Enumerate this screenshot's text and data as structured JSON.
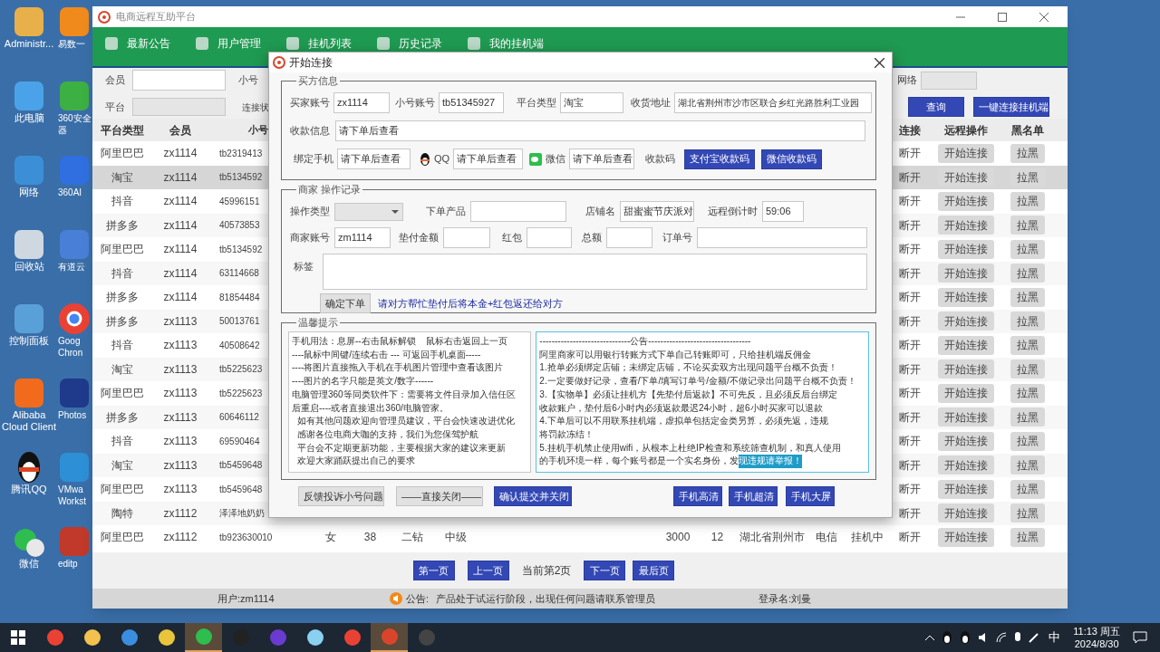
{
  "desktop": {
    "icons": [
      {
        "lines": [
          "Administr..."
        ]
      },
      {
        "lines": [
          "易数一"
        ]
      },
      {
        "lines": [
          "此电脑"
        ]
      },
      {
        "lines": [
          "360安全",
          "器"
        ]
      },
      {
        "lines": [
          "网络"
        ]
      },
      {
        "lines": [
          "360AI"
        ]
      },
      {
        "lines": [
          "回收站"
        ]
      },
      {
        "lines": [
          "有道云"
        ]
      },
      {
        "lines": [
          "控制面板"
        ]
      },
      {
        "lines": [
          "Goog",
          "Chron"
        ]
      },
      {
        "lines": [
          "Alibaba",
          "Cloud Client"
        ]
      },
      {
        "lines": [
          "Photos"
        ]
      },
      {
        "lines": [
          "腾讯QQ"
        ]
      },
      {
        "lines": [
          "VMwa",
          "Workst"
        ]
      },
      {
        "lines": [
          "微信"
        ]
      },
      {
        "lines": [
          "editp"
        ]
      }
    ]
  },
  "window": {
    "title": "电商远程互助平台",
    "nav": [
      "最新公告",
      "用户管理",
      "挂机列表",
      "历史记录",
      "我的挂机端"
    ],
    "filters": {
      "member_label": "会员",
      "account_label": "小号",
      "network_label": "网络",
      "platform_label": "平台",
      "status_label": "连接状",
      "search_button": "查询",
      "connect_all_button": "一键连接挂机端"
    },
    "table": {
      "columns": [
        "平台类型",
        "会员",
        "小号",
        "连接",
        "远程操作",
        "黑名单"
      ],
      "rows": [
        {
          "platform": "阿里巴巴",
          "member": "zx1114",
          "account": "tb2319413",
          "connection": "断开",
          "action": "开始连接",
          "blacklist": "拉黑",
          "selected": false
        },
        {
          "platform": "淘宝",
          "member": "zx1114",
          "account": "tb5134592",
          "connection": "断开",
          "action": "开始连接",
          "blacklist": "拉黑",
          "selected": true
        },
        {
          "platform": "抖音",
          "member": "zx1114",
          "account": "45996151",
          "connection": "断开",
          "action": "开始连接",
          "blacklist": "拉黑",
          "selected": false
        },
        {
          "platform": "拼多多",
          "member": "zx1114",
          "account": "40573853",
          "connection": "断开",
          "action": "开始连接",
          "blacklist": "拉黑",
          "selected": false
        },
        {
          "platform": "阿里巴巴",
          "member": "zx1114",
          "account": "tb5134592",
          "connection": "断开",
          "action": "开始连接",
          "blacklist": "拉黑",
          "selected": false
        },
        {
          "platform": "抖音",
          "member": "zx1114",
          "account": "63114668",
          "connection": "断开",
          "action": "开始连接",
          "blacklist": "拉黑",
          "selected": false
        },
        {
          "platform": "拼多多",
          "member": "zx1114",
          "account": "81854484",
          "connection": "断开",
          "action": "开始连接",
          "blacklist": "拉黑",
          "selected": false
        },
        {
          "platform": "拼多多",
          "member": "zx1113",
          "account": "50013761",
          "connection": "断开",
          "action": "开始连接",
          "blacklist": "拉黑",
          "selected": false
        },
        {
          "platform": "抖音",
          "member": "zx1113",
          "account": "40508642",
          "connection": "断开",
          "action": "开始连接",
          "blacklist": "拉黑",
          "selected": false
        },
        {
          "platform": "淘宝",
          "member": "zx1113",
          "account": "tb5225623",
          "connection": "断开",
          "action": "开始连接",
          "blacklist": "拉黑",
          "selected": false
        },
        {
          "platform": "阿里巴巴",
          "member": "zx1113",
          "account": "tb5225623",
          "connection": "断开",
          "action": "开始连接",
          "blacklist": "拉黑",
          "selected": false
        },
        {
          "platform": "拼多多",
          "member": "zx1113",
          "account": "60646112",
          "connection": "断开",
          "action": "开始连接",
          "blacklist": "拉黑",
          "selected": false
        },
        {
          "platform": "抖音",
          "member": "zx1113",
          "account": "69590464",
          "connection": "断开",
          "action": "开始连接",
          "blacklist": "拉黑",
          "selected": false
        },
        {
          "platform": "淘宝",
          "member": "zx1113",
          "account": "tb5459648",
          "connection": "断开",
          "action": "开始连接",
          "blacklist": "拉黑",
          "selected": false
        },
        {
          "platform": "阿里巴巴",
          "member": "zx1113",
          "account": "tb5459648",
          "connection": "断开",
          "action": "开始连接",
          "blacklist": "拉黑",
          "selected": false
        },
        {
          "platform": "陶特",
          "member": "zx1112",
          "account": "泽泽地奶奶",
          "connection": "断开",
          "action": "开始连接",
          "blacklist": "拉黑",
          "selected": false
        },
        {
          "platform": "阿里巴巴",
          "member": "zx1112",
          "account": "tb923630010",
          "details": {
            "column_4": "女",
            "column_5": "38",
            "column_6": "二钻",
            "column_7": "中级",
            "column_10": "3000",
            "column_11": "12",
            "column_12": "湖北省荆州市",
            "column_13": "电信",
            "column_14": "挂机中"
          },
          "connection": "断开",
          "action": "开始连接",
          "blacklist": "拉黑",
          "selected": false
        }
      ]
    },
    "pager": {
      "first": "第一页",
      "prev": "上一页",
      "current": "当前第2页",
      "next": "下一页",
      "last": "最后页"
    },
    "status_bar": {
      "user": "用户:zm1114",
      "notice_label": "公告:",
      "notice": "产品处于试运行阶段，出现任何问题请联系管理员",
      "login": "登录名:刘曼"
    }
  },
  "dialog": {
    "title": "开始连接",
    "buyer": {
      "legend": "买方信息",
      "buyer_account": {
        "label": "买家账号",
        "value": "zx1114"
      },
      "sub_account": {
        "label": "小号账号",
        "value": "tb51345927"
      },
      "platform": {
        "label": "平台类型",
        "value": "淘宝"
      },
      "address": {
        "label": "收货地址",
        "value": "湖北省荆州市沙市区联合乡红光路胜利工业园"
      },
      "payment_info": {
        "label": "收款信息",
        "value": "请下单后查看"
      },
      "phone": {
        "label": "绑定手机",
        "value": "请下单后查看"
      },
      "qq": {
        "label": "QQ",
        "value": "请下单后查看"
      },
      "wechat": {
        "label": "微信",
        "value": "请下单后查看"
      },
      "code_label": "收款码",
      "alipay_button": "支付宝收款码",
      "wechat_button": "微信收款码"
    },
    "merchant": {
      "legend": "商家 操作记录",
      "op_type_label": "操作类型",
      "product": {
        "label": "下单产品"
      },
      "shop": {
        "label": "店铺名",
        "value": "甜蜜蜜节庆派对"
      },
      "countdown": {
        "label": "远程倒计时",
        "value": "59:06"
      },
      "merchant_account": {
        "label": "商家账号",
        "value": "zm1114"
      },
      "advance": {
        "label": "垫付金额"
      },
      "red_packet": {
        "label": "红包"
      },
      "total": {
        "label": "总额"
      },
      "order_no": {
        "label": "订单号"
      },
      "tag_label": "标签",
      "confirm_button": "确定下单",
      "hint": "请对方帮忙垫付后将本金+红包返还给对方"
    },
    "tips": {
      "legend": "温馨提示",
      "left_lines": [
        "手机用法：息屏--右击鼠标解锁    鼠标右击返回上一页",
        "----鼠标中间键/连续右击 --- 可返回手机桌面-----",
        "----将图片直接拖入手机在手机图片管理中查看该图片",
        "----图片的名字只能是英文/数字------",
        "电脑管理360等同类软件下：需要将文件目录加入信任区",
        "后重启----或者直接退出360/电脑管家。",
        "  如有其他问题欢迎向管理员建议，平台会快速改进优化",
        "  感谢各位电商大咖的支持，我们为您保驾护航",
        "  平台会不定期更新功能，主要根据大家的建议来更新",
        "  欢迎大家踊跃提出自己的要求"
      ],
      "right_lines": [
        "------------------------------公告----------------------------------",
        "阿里商家可以用银行转账方式下单自己转账即可，只给挂机端反佣金",
        "1.抢单必须绑定店铺；未绑定店铺，不论买卖双方出现问题平台概不负责！",
        "2.一定要做好记录，查看/下单/填写订单号/金额/不做记录出问题平台概不负责！",
        "3.【实物单】必须让挂机方【先垫付后返款】不可先反，且必须反后台绑定",
        "收款账户，垫付后6小时内必须返款最迟24小时，超6小时买家可以退款",
        "4.下单后可以不用联系挂机端，虚拟单包括定金类另算，必须先返，违规",
        "将罚款冻结！",
        "5.挂机手机禁止使用wifi，从根本上杜绝IP检查和系统筛查机制，和真人使用"
      ],
      "last_line": "的手机环境一样，每个账号都是一个实名身份，发",
      "last_line_selected": "现违规请举报！"
    },
    "buttons": [
      {
        "label": "反馈投诉小号问题",
        "kind": "plain"
      },
      {
        "label": "——直接关闭——",
        "kind": "plain"
      },
      {
        "label": "确认提交并关闭",
        "kind": "primary"
      },
      {
        "label": "手机高清",
        "kind": "primary"
      },
      {
        "label": "手机超清",
        "kind": "primary"
      },
      {
        "label": "手机大屏",
        "kind": "primary"
      }
    ]
  },
  "taskbar": {
    "apps": [
      {
        "selected": false
      },
      {
        "selected": false
      },
      {
        "selected": false
      },
      {
        "selected": false
      },
      {
        "selected": true
      },
      {
        "selected": false
      },
      {
        "selected": false
      },
      {
        "selected": false
      },
      {
        "selected": false
      },
      {
        "selected": true
      },
      {
        "selected": false
      }
    ],
    "ime": "中",
    "time": "11:13 周五",
    "date": "2024/8/30"
  }
}
